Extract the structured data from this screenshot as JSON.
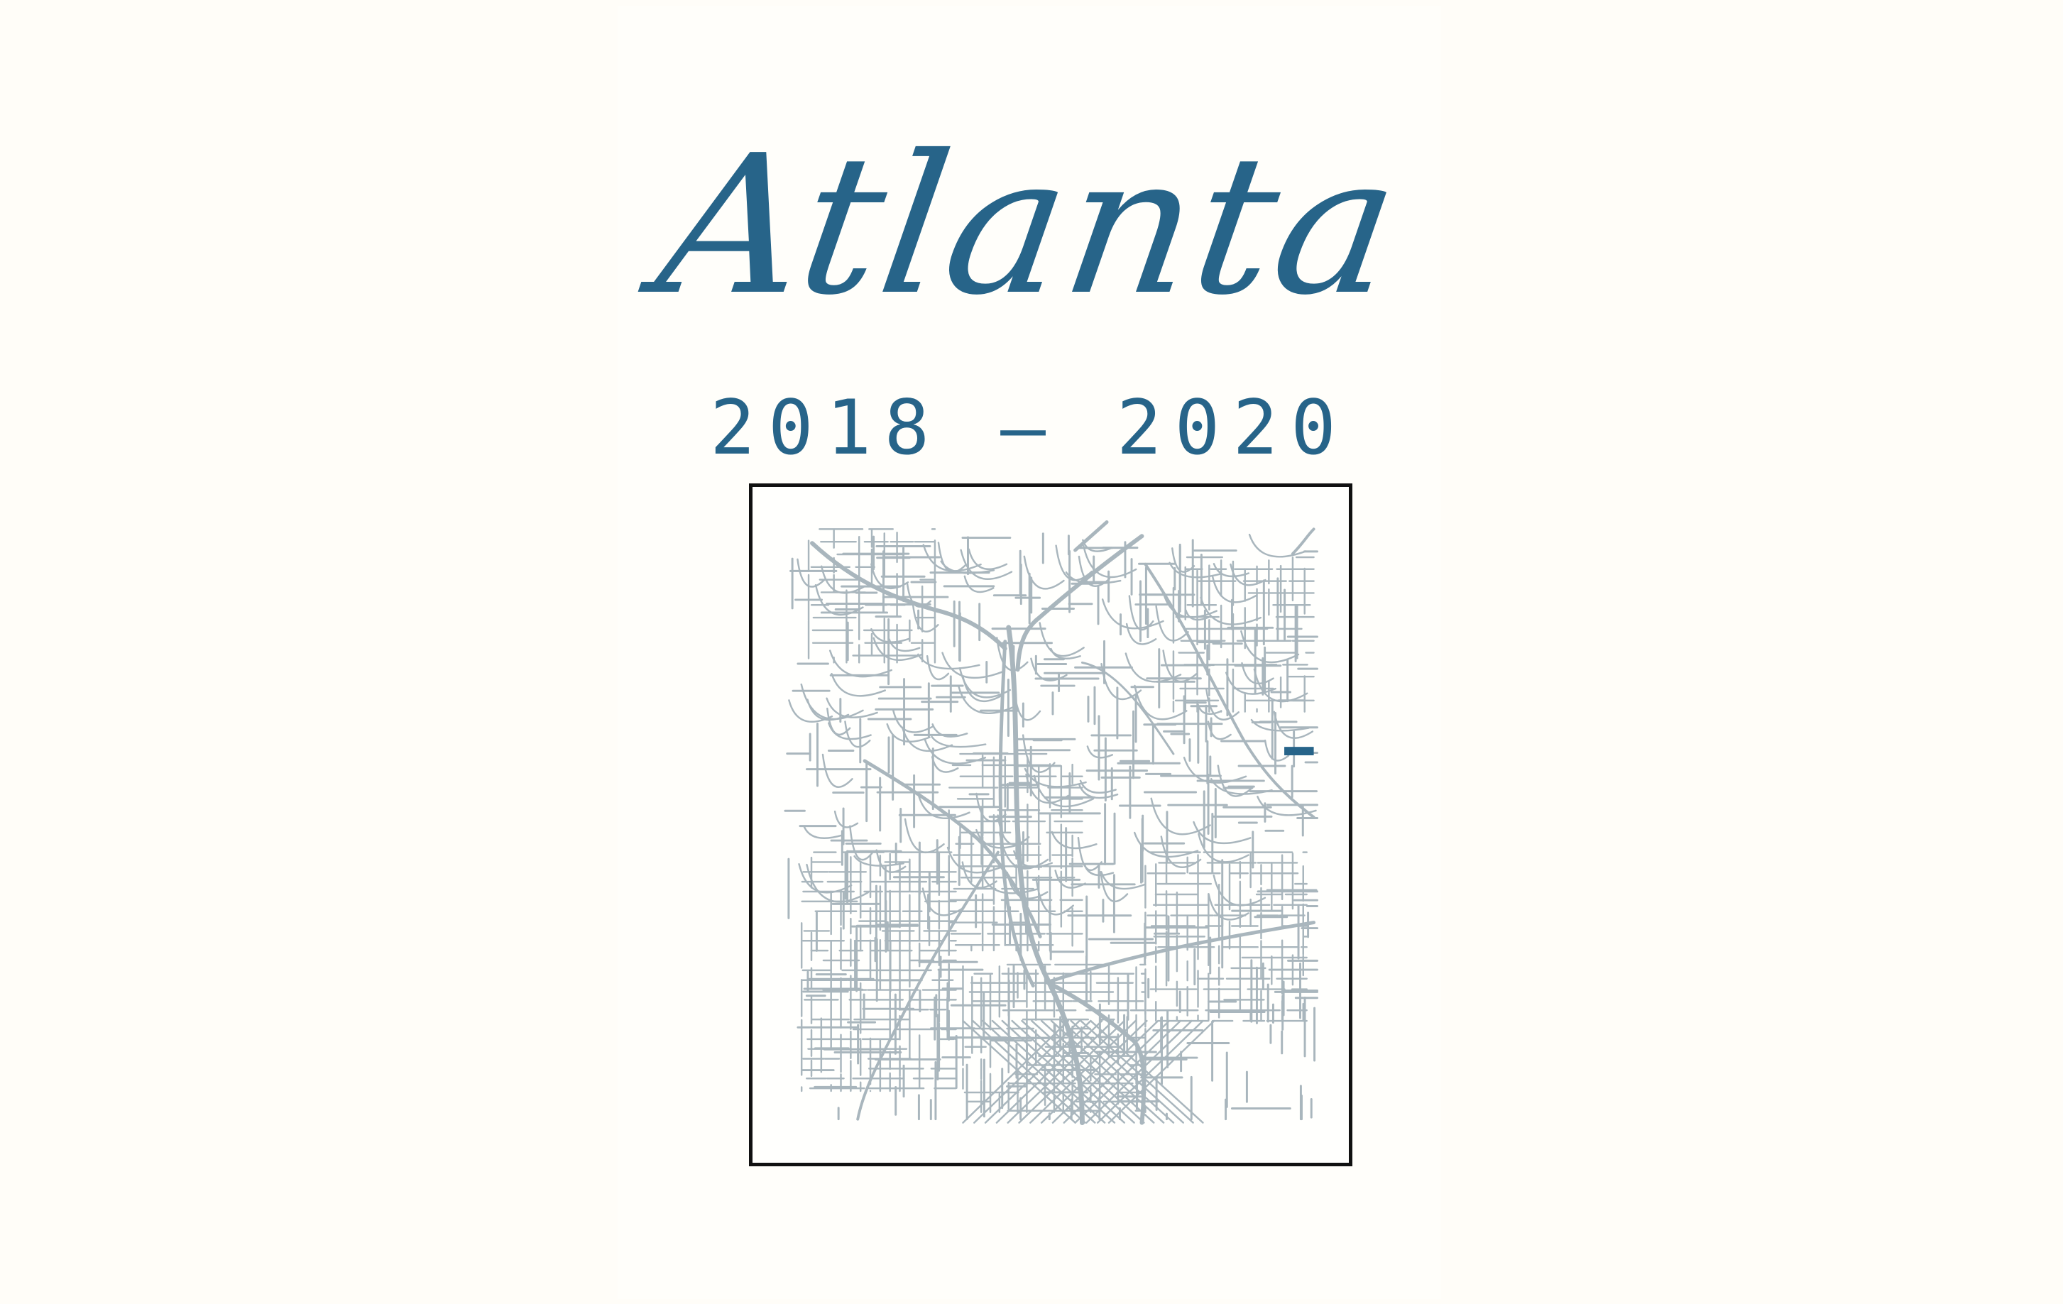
{
  "poster": {
    "title": "Atlanta",
    "years": "2018 – 2020"
  },
  "colors": {
    "accent": "#276489",
    "roads": "#a9b6bd",
    "frame": "#111111",
    "highlight": "#276489"
  },
  "map": {
    "description": "",
    "marker_icon": "highlight-road-icon"
  }
}
